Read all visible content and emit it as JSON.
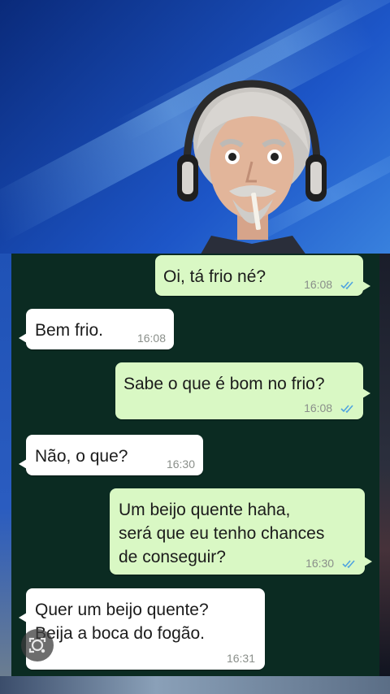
{
  "messages": [
    {
      "dir": "out",
      "text": "Oi, tá frio né?",
      "time": "16:08",
      "read": true
    },
    {
      "dir": "in",
      "text": "Bem frio.",
      "time": "16:08"
    },
    {
      "dir": "out",
      "text": "Sabe o que é bom no frio?",
      "time": "16:08",
      "read": true
    },
    {
      "dir": "in",
      "text": "Não, o que?",
      "time": "16:30"
    },
    {
      "dir": "out",
      "lines": [
        "Um beijo quente haha,",
        "será que eu tenho chances",
        "de conseguir?"
      ],
      "time": "16:30",
      "read": true
    },
    {
      "dir": "in",
      "lines": [
        "Quer um beijo quente?",
        "Beija a boca do fogão."
      ],
      "time": "16:31"
    }
  ],
  "icons": {
    "read_receipt": "double-check-icon",
    "lens": "lens-search-icon"
  },
  "colors": {
    "chat_background": "#0b2b22",
    "outgoing_bubble": "#d9f8c4",
    "incoming_bubble": "#ffffff",
    "read_ticks": "#4fa3e0",
    "studio_background": "#1d56c8"
  }
}
